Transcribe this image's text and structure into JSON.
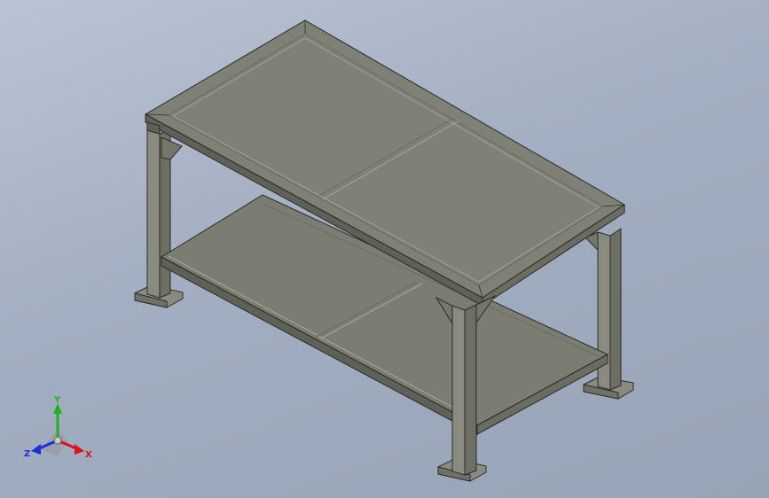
{
  "viewport": {
    "background_top": "#b9c3d3",
    "background_bottom": "#97a3b6"
  },
  "model": {
    "name": "workbench",
    "surface_color": "#7c7d72",
    "top_face_color": "#7f8076",
    "edge_color": "#2b2b26",
    "highlight_color": "#a8a99c"
  },
  "triad": {
    "y_label": "Y",
    "x_label": "X",
    "z_label": "Z",
    "x_color": "#e0101a",
    "y_color": "#1fb21f",
    "z_color": "#1a2ed6"
  }
}
